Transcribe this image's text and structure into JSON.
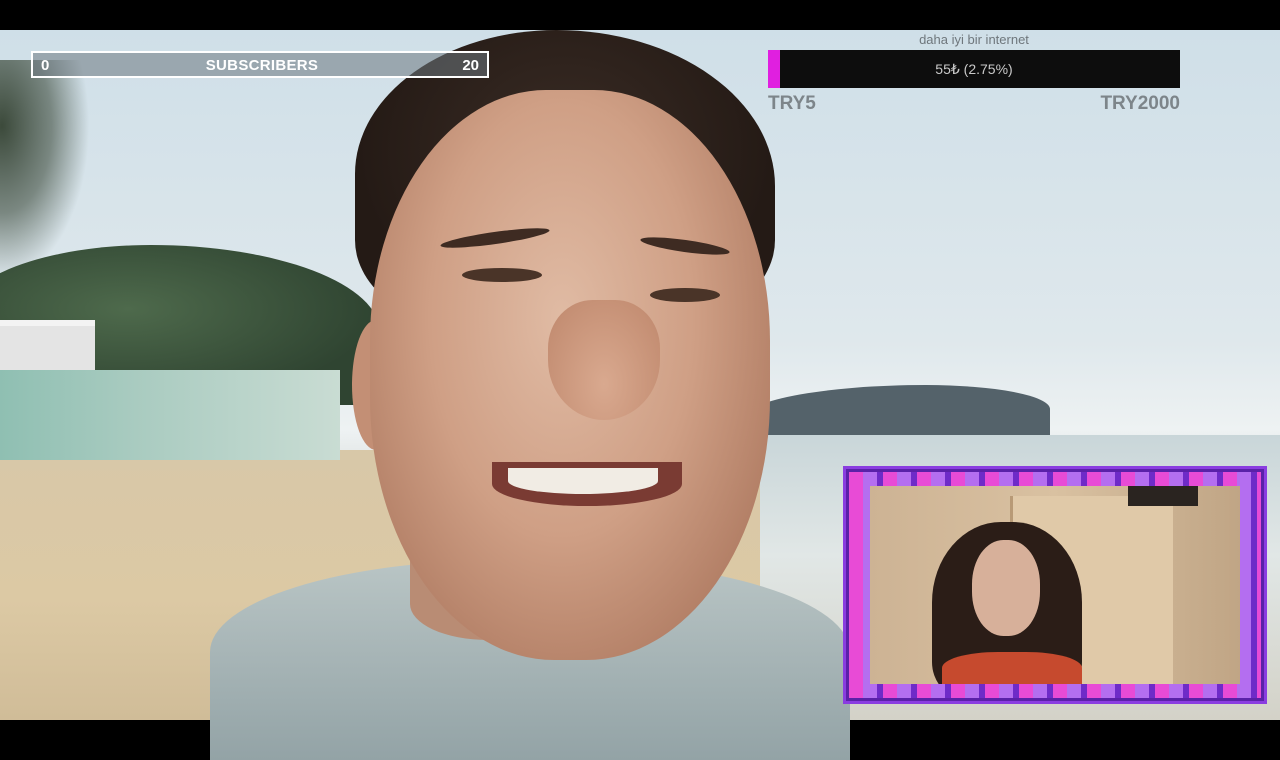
{
  "subscribers_bar": {
    "min": "0",
    "label": "SUBSCRIBERS",
    "max": "20"
  },
  "donation_goal": {
    "title": "daha iyi bir internet",
    "progress_text": "55₺ (2.75%)",
    "progress_fraction": 0.0275,
    "min_label": "TRY5",
    "max_label": "TRY2000",
    "fill_color": "#e01fe0"
  },
  "webcam_frame_colors": [
    "#e84bd6",
    "#b46ef0",
    "#6e2bc8"
  ]
}
